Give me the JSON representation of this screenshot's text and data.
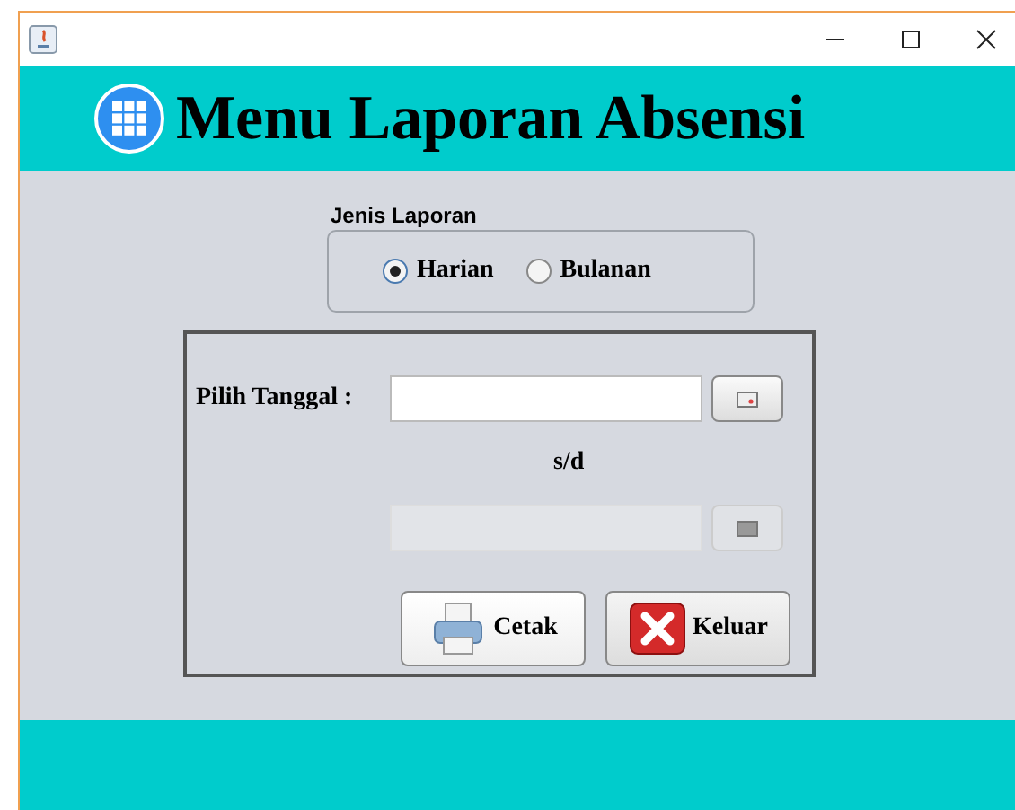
{
  "header": {
    "title": "Menu Laporan Absensi"
  },
  "report_type": {
    "label": "Jenis Laporan",
    "options": [
      {
        "label": "Harian",
        "selected": true
      },
      {
        "label": "Bulanan",
        "selected": false
      }
    ]
  },
  "date_range": {
    "label": "Pilih Tanggal :",
    "separator": "s/d",
    "fields": [
      {
        "disabled": false
      },
      {
        "disabled": true
      }
    ]
  },
  "buttons": [
    {
      "label": "Cetak",
      "kind": "print"
    },
    {
      "label": "Keluar",
      "kind": "exit"
    }
  ]
}
